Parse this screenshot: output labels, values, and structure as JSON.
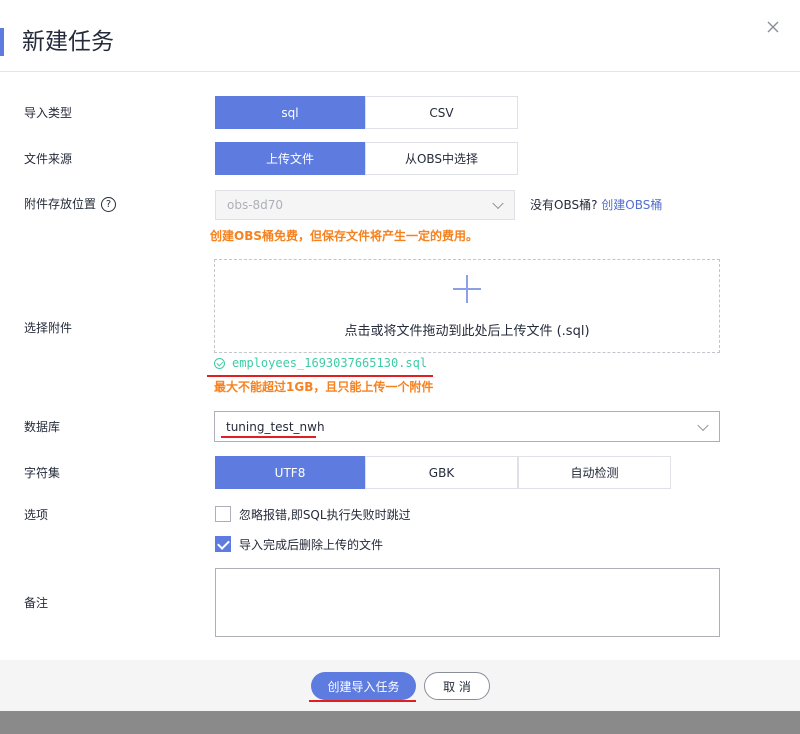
{
  "dialog": {
    "title": "新建任务",
    "close_icon": "close-icon"
  },
  "form": {
    "import_type": {
      "label": "导入类型",
      "options": [
        "sql",
        "CSV"
      ],
      "selected": "sql"
    },
    "file_source": {
      "label": "文件来源",
      "options": [
        "上传文件",
        "从OBS中选择"
      ],
      "selected": "上传文件"
    },
    "storage": {
      "label": "附件存放位置",
      "help_glyph": "?",
      "value": "obs-8d70",
      "no_bucket_text": "没有OBS桶?",
      "create_link": "创建OBS桶",
      "notice": "创建OBS桶免费，但保存文件将产生一定的费用。"
    },
    "attachment": {
      "label": "选择附件",
      "drop_text": "点击或将文件拖动到此处后上传文件 (.sql)",
      "uploaded_file": "employees_1693037665130.sql",
      "notice": "最大不能超过1GB，且只能上传一个附件"
    },
    "database": {
      "label": "数据库",
      "value": "tuning_test_nwh"
    },
    "charset": {
      "label": "字符集",
      "options": [
        "UTF8",
        "GBK",
        "自动检测"
      ],
      "selected": "UTF8"
    },
    "options": {
      "label": "选项",
      "items": [
        {
          "label": "忽略报错,即SQL执行失败时跳过",
          "checked": false
        },
        {
          "label": "导入完成后删除上传的文件",
          "checked": true
        }
      ]
    },
    "remark": {
      "label": "备注"
    }
  },
  "footer": {
    "primary_label": "创建导入任务",
    "cancel_label": "取 消"
  },
  "colors": {
    "accent": "#5e7ce0",
    "notice": "#f6821f",
    "success": "#3dcca6",
    "annotation": "#e02020"
  }
}
